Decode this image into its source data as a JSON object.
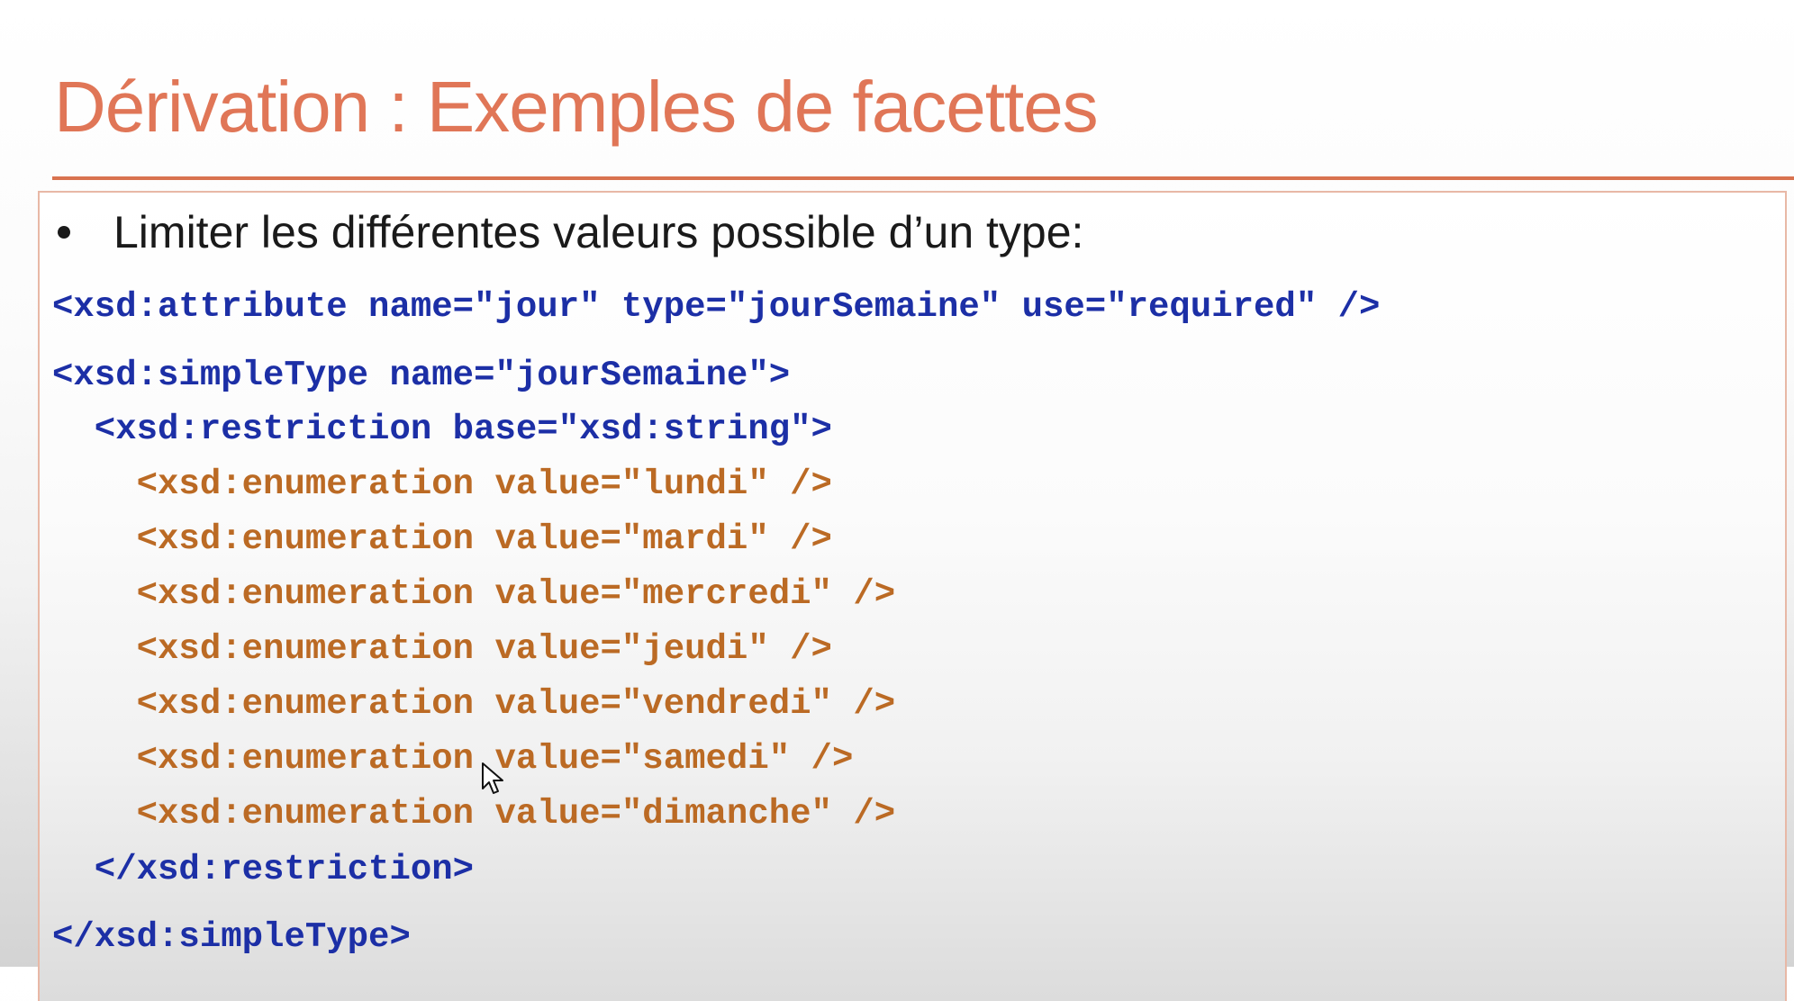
{
  "slide": {
    "title": "Dérivation : Exemples de facettes",
    "bullet": "Limiter les différentes valeurs possible d’un type:"
  },
  "code": {
    "lines": [
      "<xsd:attribute name=\"jour\" type=\"jourSemaine\" use=\"required\" />",
      "<xsd:simpleType name=\"jourSemaine\">",
      "  <xsd:restriction base=\"xsd:string\">",
      "    <xsd:enumeration value=\"lundi\" />",
      "    <xsd:enumeration value=\"mardi\" />",
      "    <xsd:enumeration value=\"mercredi\" />",
      "    <xsd:enumeration value=\"jeudi\" />",
      "    <xsd:enumeration value=\"vendredi\" />",
      "    <xsd:enumeration value=\"samedi\" />",
      "    <xsd:enumeration value=\"dimanche\" />",
      "  </xsd:restriction>",
      "</xsd:simpleType>"
    ]
  },
  "colors": {
    "title": "#e07657",
    "rule": "#d9734f",
    "code_blue": "#1c2fa6",
    "code_orange": "#bb6a24"
  },
  "icons": {
    "cursor": "mouse-pointer-icon",
    "bullet": "bullet-dot-icon"
  }
}
